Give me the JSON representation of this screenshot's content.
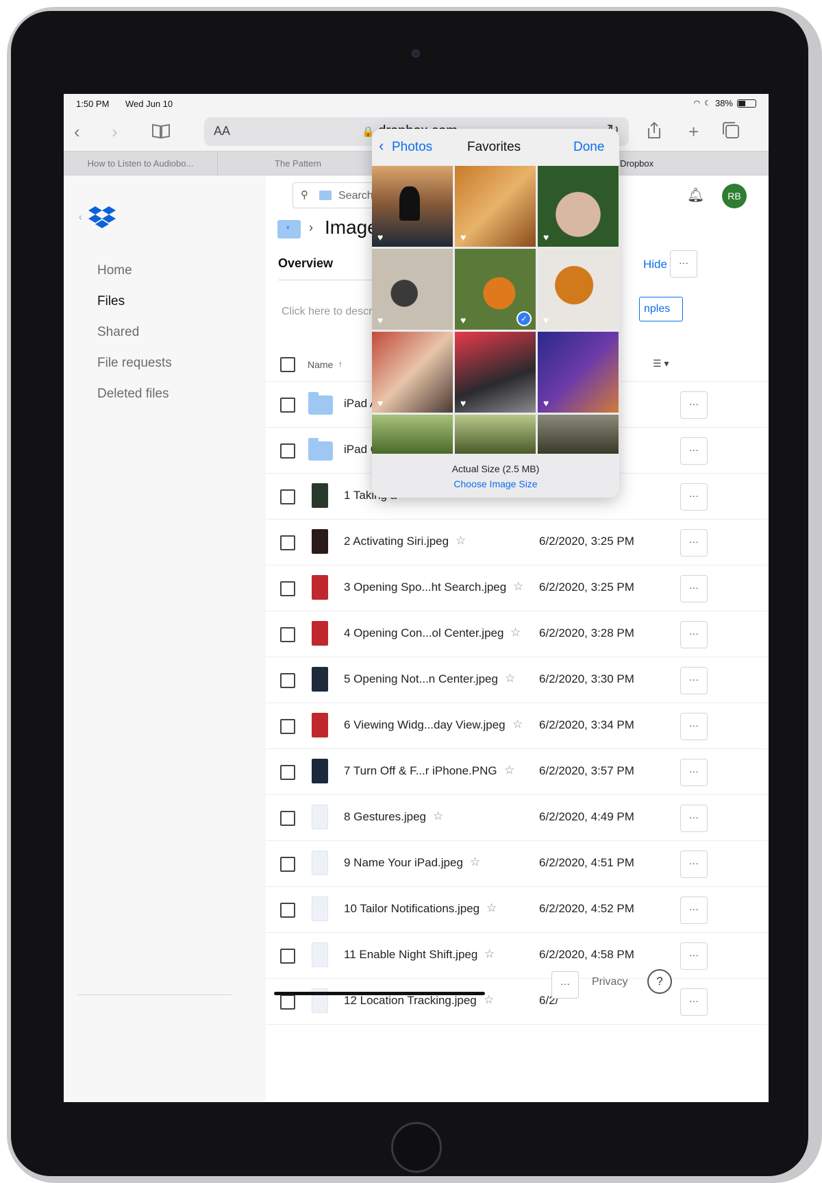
{
  "status_bar": {
    "time": "1:50 PM",
    "date": "Wed Jun 10",
    "battery": "38%"
  },
  "browser": {
    "text_size_label": "AA",
    "url": "dropbox.com",
    "tabs": [
      "How to Listen to Audiobo...",
      "The Pattern",
      "Dropbox"
    ]
  },
  "sidebar": {
    "items": [
      "Home",
      "Files",
      "Shared",
      "File requests",
      "Deleted files"
    ]
  },
  "header": {
    "search_placeholder": "Search",
    "avatar_initials": "RB",
    "avatar_color": "#2e7d32"
  },
  "folder": {
    "title": "Images",
    "overview_label": "Overview",
    "hide_label": "Hide",
    "description_placeholder": "Click here to describe",
    "examples_label": "nples"
  },
  "table": {
    "name_header": "Name",
    "rows": [
      {
        "name": "iPad Apps",
        "date": "",
        "type": "folder",
        "starred": false
      },
      {
        "name": "iPad Gear",
        "date": "",
        "type": "folder",
        "starred": false
      },
      {
        "name": "1 Taking a",
        "date": "",
        "type": "image",
        "starred": false
      },
      {
        "name": "2 Activating Siri.jpeg",
        "date": "6/2/2020, 3:25 PM",
        "type": "image",
        "starred": true
      },
      {
        "name": "3 Opening Spo...ht Search.jpeg",
        "date": "6/2/2020, 3:25 PM",
        "type": "image",
        "starred": true
      },
      {
        "name": "4 Opening Con...ol Center.jpeg",
        "date": "6/2/2020, 3:28 PM",
        "type": "image",
        "starred": true
      },
      {
        "name": "5 Opening Not...n Center.jpeg",
        "date": "6/2/2020, 3:30 PM",
        "type": "image",
        "starred": true
      },
      {
        "name": "6 Viewing Widg...day View.jpeg",
        "date": "6/2/2020, 3:34 PM",
        "type": "image",
        "starred": true
      },
      {
        "name": "7 Turn Off & F...r iPhone.PNG",
        "date": "6/2/2020, 3:57 PM",
        "type": "image",
        "starred": true
      },
      {
        "name": "8 Gestures.jpeg",
        "date": "6/2/2020, 4:49 PM",
        "type": "image-light",
        "starred": true
      },
      {
        "name": "9 Name Your iPad.jpeg",
        "date": "6/2/2020, 4:51 PM",
        "type": "image-light",
        "starred": true
      },
      {
        "name": "10 Tailor Notifications.jpeg",
        "date": "6/2/2020, 4:52 PM",
        "type": "image-light",
        "starred": true
      },
      {
        "name": "11 Enable Night Shift.jpeg",
        "date": "6/2/2020, 4:58 PM",
        "type": "image-light",
        "starred": true
      },
      {
        "name": "12 Location Tracking.jpeg",
        "date": "6/2/",
        "type": "image-light",
        "starred": true
      }
    ],
    "more_label": "···"
  },
  "photo_picker": {
    "back_label": "Photos",
    "title": "Favorites",
    "done_label": "Done",
    "size_label": "Actual Size (2.5 MB)",
    "choose_size_label": "Choose Image Size"
  },
  "footer": {
    "privacy_label": "Privacy",
    "help_label": "?"
  },
  "colors": {
    "accent": "#0a6ef0",
    "dropbox_blue": "#0b61d8"
  }
}
